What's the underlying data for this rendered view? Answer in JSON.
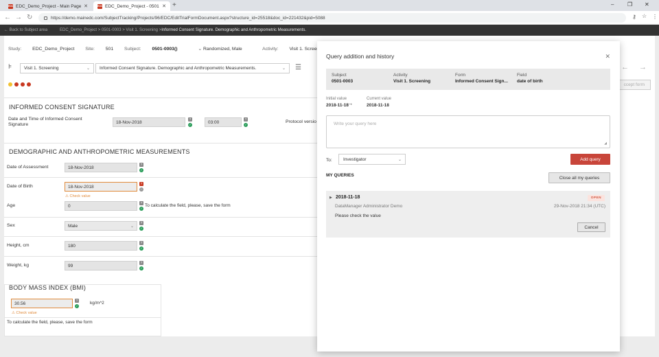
{
  "browser": {
    "tabs": [
      {
        "title": "EDC_Demo_Project - Main Page",
        "favicon": "EDC"
      },
      {
        "title": "EDC_Demo_Project - 0501-0003",
        "favicon": "EDC"
      }
    ],
    "url": "https://demo.mainedc.com/SubjectTracking/Projects/96/EDC/EditTrialFormDocument.aspx?structure_id=25518&doc_id=221432&pid=5088",
    "icons": [
      "back-arrow-icon",
      "forward-arrow-icon",
      "reload-icon",
      "lock-icon",
      "key-icon",
      "star-icon",
      "profile-avatar-icon",
      "menu-dots-icon"
    ]
  },
  "appbar": {
    "back_label": "← Back to Subject area",
    "crumbs": "EDC_Demo_Project > 0501-0003 > Visit 1. Screening > ",
    "current": "Informed Consent Signature. Demographic and Anthropometric Measurements."
  },
  "study": {
    "study_label": "Study:",
    "study_value": "EDC_Demo_Project",
    "site_label": "Site:",
    "site_value": "501",
    "subject_label": "Subject:",
    "subject_value": "0501-0003()",
    "status": "Randomized, Male",
    "activity_label": "Activity:",
    "activity_value": "Visit 1. Screening"
  },
  "toolbar": {
    "visit_select": "Visit 1. Screening",
    "form_select": "Informed Consent Signature. Demographic and Anthropometric Measurements.",
    "accept_label": "ccept form"
  },
  "sections": {
    "consent": {
      "title": "INFORMED CONSENT SIGNATURE",
      "date_label": "Date and Time of Informed Consent Signature",
      "date_value": "18-Nov-2018",
      "time_value": "03:00",
      "protocol_label": "Protocol versio"
    },
    "demographic": {
      "title": "DEMOGRAPHIC AND ANTHROPOMETRIC MEASUREMENTS",
      "assessment_label": "Date of Assessment",
      "assessment_value": "18-Nov-2018",
      "dob_label": "Date of Birth",
      "dob_value": "18-Nov-2018",
      "dob_warning": "Check value",
      "age_label": "Age",
      "age_value": "0",
      "age_note": "To calculate the field, please, save the form",
      "sex_label": "Sex",
      "sex_value": "Male",
      "height_label": "Height, cm",
      "height_value": "180",
      "weight_label": "Weight, kg",
      "weight_value": "99"
    },
    "bmi": {
      "title": "BODY MASS INDEX (BMI)",
      "value": "30.56",
      "unit": "kg/m^2",
      "warning": "Check value",
      "note": "To calculate the field, please, save the form"
    }
  },
  "modal": {
    "title": "Query addition and history",
    "info": [
      {
        "key": "Subject",
        "value": "0501-0003"
      },
      {
        "key": "Activity",
        "value": "Visit 1. Screening"
      },
      {
        "key": "Form",
        "value": "Informed Consent Sign..."
      },
      {
        "key": "Field",
        "value": "date of birth"
      }
    ],
    "initial_label": "Initial value",
    "initial_value": "2018-11-18",
    "current_label": "Current value",
    "current_value": "2018-11-18",
    "textarea_placeholder": "Write your query here",
    "to_label": "To:",
    "to_value": "Investigator",
    "add_query_label": "Add query",
    "my_queries_label": "MY QUERIES",
    "close_all_label": "Close all my queries",
    "queries": [
      {
        "date": "2018-11-18",
        "status": "OPEN",
        "author": "DataManager Administrator Demo",
        "time": "29-Nov-2018 21:34 (UTC)",
        "text": "Please check the value",
        "cancel_label": "Cancel"
      }
    ]
  },
  "colors": {
    "accent_red": "#c8453a",
    "ok_green": "#2a9d5a",
    "warn_orange": "#e08a3a",
    "dark_bar": "#333333"
  }
}
